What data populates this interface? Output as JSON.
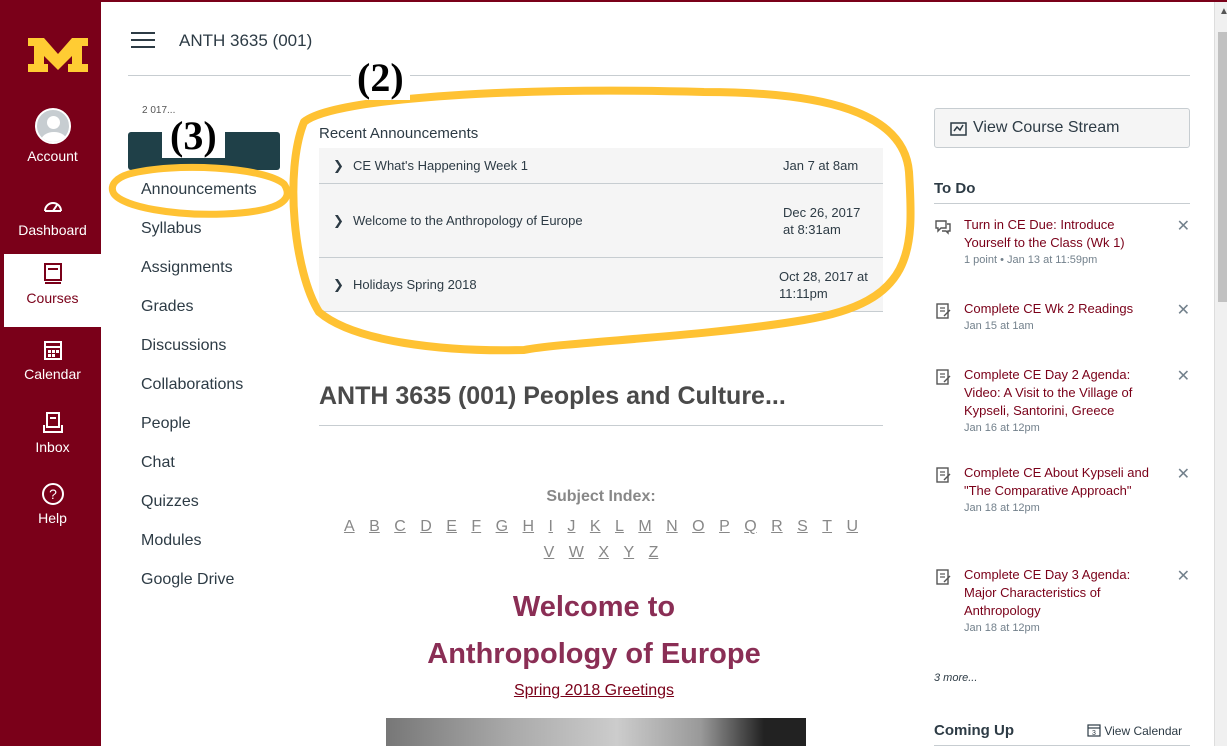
{
  "header": {
    "breadcrumb": "ANTH 3635 (001)"
  },
  "global_nav": [
    {
      "label": "Account"
    },
    {
      "label": "Dashboard"
    },
    {
      "label": "Courses"
    },
    {
      "label": "Calendar"
    },
    {
      "label": "Inbox"
    },
    {
      "label": "Help"
    }
  ],
  "course_nav": {
    "date_fragment": "2          017...",
    "items": [
      "Announcements",
      "Syllabus",
      "Assignments",
      "Grades",
      "Discussions",
      "Collaborations",
      "People",
      "Chat",
      "Quizzes",
      "Modules",
      "Google Drive"
    ]
  },
  "announcements": {
    "title": "Recent Announcements",
    "rows": [
      {
        "title": "CE What's Happening Week 1",
        "date": "Jan 7 at 8am"
      },
      {
        "title": "Welcome to the Anthropology of Europe",
        "date": "Dec 26, 2017 at 8:31am"
      },
      {
        "title": "Holidays Spring 2018",
        "date": "Oct 28, 2017 at 11:11pm"
      }
    ]
  },
  "main": {
    "course_title": "ANTH 3635 (001) Peoples and Culture...",
    "subject_index_label": "Subject Index:",
    "letters": [
      "A",
      "B",
      "C",
      "D",
      "E",
      "F",
      "G",
      "H",
      "I",
      "J",
      "K",
      "L",
      "M",
      "N",
      "O",
      "P",
      "Q",
      "R",
      "S",
      "T",
      "U",
      "V",
      "W",
      "X",
      "Y",
      "Z"
    ],
    "welcome_line1": "Welcome to",
    "welcome_line2": "Anthropology of Europe",
    "greetings_link": "Spring 2018 Greetings"
  },
  "sidebar": {
    "stream_button": "View Course Stream",
    "todo_heading": "To Do",
    "todo": [
      {
        "title": "Turn in CE Due: Introduce Yourself to the Class (Wk 1)",
        "meta": "1 point • Jan 13 at 11:59pm",
        "icon": "discussion-icon"
      },
      {
        "title": "Complete CE Wk 2 Readings",
        "meta": "Jan 15 at 1am",
        "icon": "assignment-icon"
      },
      {
        "title": "Complete CE Day 2 Agenda: Video: A Visit to the Village of Kypseli, Santorini, Greece",
        "meta": "Jan 16 at 12pm",
        "icon": "assignment-icon"
      },
      {
        "title": "Complete CE About Kypseli and \"The Comparative Approach\"",
        "meta": "Jan 18 at 12pm",
        "icon": "assignment-icon"
      },
      {
        "title": "Complete CE Day 3 Agenda: Major Characteristics of Anthropology",
        "meta": "Jan 18 at 12pm",
        "icon": "assignment-icon"
      }
    ],
    "more_link": "3 more...",
    "coming_up_heading": "Coming Up",
    "view_calendar": "View Calendar"
  },
  "annotations": {
    "label_2": "(2)",
    "label_3": "(3)"
  },
  "colors": {
    "brand": "#7a0019",
    "highlight": "#ffc233",
    "link": "#7a0019"
  }
}
